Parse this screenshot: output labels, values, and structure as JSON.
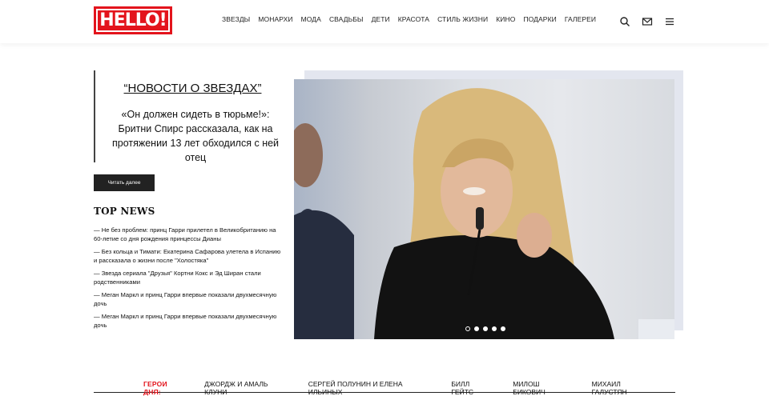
{
  "logo": {
    "text": "HELLO!"
  },
  "nav": [
    "ЗВЕЗДЫ",
    "МОНАРХИ",
    "МОДА",
    "СВАДЬБЫ",
    "ДЕТИ",
    "КРАСОТА",
    "СТИЛЬ ЖИЗНИ",
    "КИНО",
    "ПОДАРКИ",
    "ГАЛЕРЕИ"
  ],
  "header_icons": [
    "search-icon",
    "mail-icon",
    "menu-icon"
  ],
  "feature": {
    "rubric": "“НОВОСТИ О ЗВЕЗДАХ”",
    "headline": "«Он должен сидеть в тюрьме!»: Бритни Спирс рассказала, как на протяжении 13 лет обходился с ней отец",
    "read_more": "Читать далее",
    "slides_total": 5,
    "active_slide": 1
  },
  "top_news": {
    "title": "TOP NEWS",
    "items": [
      "— Не без проблем: принц Гарри прилетел в Великобританию на 60-летие со дня рождения принцессы Дианы",
      "— Без кольца и Тимати: Екатерина Сафарова улетела в Испанию и рассказала о жизни после \"Холостяка\"",
      "— Звезда сериала \"Друзья\" Кортни Кокс и Эд Ширан стали родственниками",
      "— Меган Маркл и принц Гарри впервые показали двухмесячную дочь",
      "— Меган Маркл и принц Гарри впервые показали двухмесячную дочь"
    ]
  },
  "heroes": {
    "label": "ГЕРОИ ДНЯ:",
    "names": [
      "ДЖОРДЖ И АМАЛЬ КЛУНИ",
      "СЕРГЕЙ ПОЛУНИН И ЕЛЕНА ИЛЬИНЫХ",
      "БИЛЛ ГЕЙТС",
      "МИЛОШ БИКОВИЧ",
      "МИХАИЛ ГАЛУСТЯН"
    ]
  },
  "colors": {
    "brand": "#e3141c",
    "button": "#222222"
  }
}
